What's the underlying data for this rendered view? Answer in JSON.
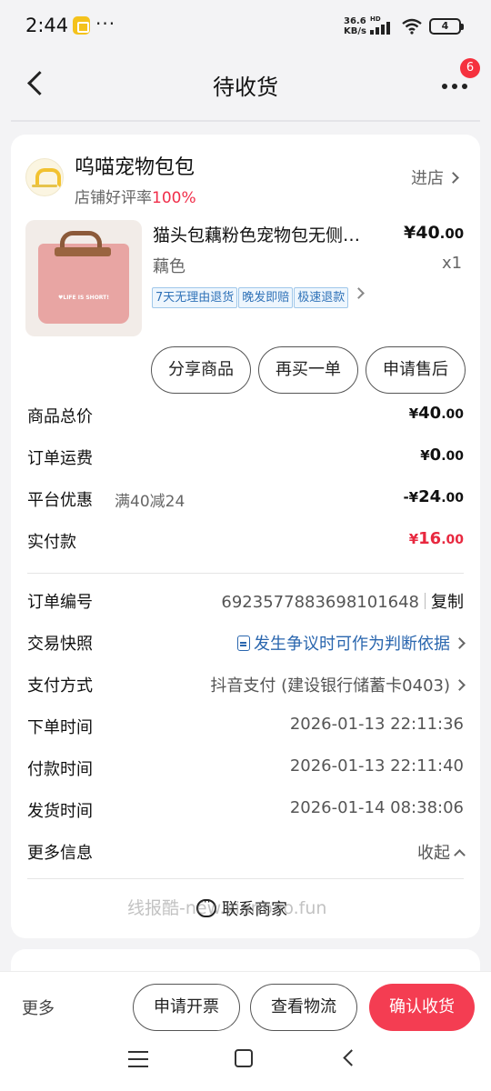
{
  "status_bar": {
    "time": "2:44",
    "dots": "···",
    "net_speed": "36.6 KB/s",
    "hd": "HD",
    "battery": "4"
  },
  "header": {
    "title": "待收货",
    "badge": "6"
  },
  "shop": {
    "name": "呜喵宠物包包",
    "rating_label": "店铺好评率",
    "rating_value": "100%",
    "enter_label": "进店"
  },
  "product": {
    "title": "猫头包藕粉色宠物包无侧…",
    "price_int": "¥40",
    "price_dec": ".00",
    "spec": "藕色",
    "qty": "x1",
    "tags": [
      "7天无理由退货",
      "晚发即赔",
      "极速退款"
    ],
    "image_text": "♥LIFE IS SHORT!"
  },
  "actions": {
    "share": "分享商品",
    "rebuy": "再买一单",
    "after_sale": "申请售后"
  },
  "pricing": {
    "total_label": "商品总价",
    "total_yen": "¥",
    "total_int": "40",
    "total_dec": ".00",
    "shipping_label": "订单运费",
    "shipping_yen": "¥",
    "shipping_int": "0",
    "shipping_dec": ".00",
    "discount_label": "平台优惠",
    "discount_desc": "满40减24",
    "discount_yen": "-¥",
    "discount_int": "24",
    "discount_dec": ".00",
    "paid_label": "实付款",
    "paid_yen": "¥",
    "paid_int": "16",
    "paid_dec": ".00"
  },
  "order_info": {
    "order_no_label": "订单编号",
    "order_no": "6923577883698101648",
    "copy_label": "复制",
    "snapshot_label": "交易快照",
    "snapshot_value": "发生争议时可作为判断依据",
    "payment_label": "支付方式",
    "payment_value": "抖音支付 (建设银行储蓄卡0403)",
    "order_time_label": "下单时间",
    "order_time": "2026-01-13 22:11:36",
    "pay_time_label": "付款时间",
    "pay_time": "2026-01-13 22:11:40",
    "ship_time_label": "发货时间",
    "ship_time": "2026-01-14 08:38:06",
    "more_info_label": "更多信息",
    "collapse_label": "收起"
  },
  "contact_label": "联系商家",
  "watermark": "线报酷-new.xianbao.fun",
  "bottom_bar": {
    "more": "更多",
    "invoice": "申请开票",
    "logistics": "查看物流",
    "confirm": "确认收货"
  },
  "colors": {
    "accent_red": "#f43d52",
    "link_blue": "#2a66ae",
    "tag_blue": "#2f72b8"
  }
}
